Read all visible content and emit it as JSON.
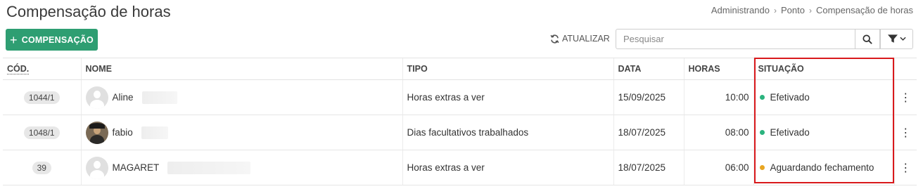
{
  "page": {
    "title": "Compensação de horas",
    "breadcrumb": [
      "Administrando",
      "Ponto",
      "Compensação de horas"
    ]
  },
  "toolbar": {
    "add_label": "COMPENSAÇÃO",
    "refresh_label": "ATUALIZAR",
    "search_placeholder": "Pesquisar"
  },
  "table": {
    "columns": {
      "code": "CÓD.",
      "name": "NOME",
      "type": "TIPO",
      "date": "DATA",
      "hours": "HORAS",
      "status": "SITUAÇÃO"
    },
    "rows": [
      {
        "code": "1044/1",
        "name": "Aline",
        "avatar": "placeholder",
        "type": "Horas extras a ver",
        "date": "15/09/2025",
        "hours": "10:00",
        "status": "Efetivado",
        "status_color": "#2bb37e"
      },
      {
        "code": "1048/1",
        "name": "fabio",
        "avatar": "photo",
        "type": "Dias facultativos trabalhados",
        "date": "18/07/2025",
        "hours": "08:00",
        "status": "Efetivado",
        "status_color": "#2bb37e"
      },
      {
        "code": "39",
        "name": "MAGARET",
        "avatar": "placeholder",
        "type": "Horas extras a ver",
        "date": "18/07/2025",
        "hours": "06:00",
        "status": "Aguardando fechamento",
        "status_color": "#e8a521"
      }
    ]
  },
  "colors": {
    "accent": "#2e9e72",
    "highlight": "#d9191c"
  }
}
